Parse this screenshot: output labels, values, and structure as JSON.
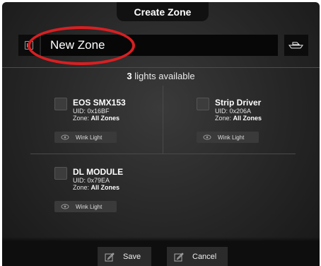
{
  "header": {
    "title": "Create Zone"
  },
  "zone_name": {
    "value": "New Zone"
  },
  "lights": {
    "count": "3",
    "count_suffix": "lights available"
  },
  "cards": [
    {
      "name": "EOS SMX153",
      "uid": "UID: 0x16BF",
      "zone_prefix": "Zone:",
      "zone_value": "All Zones",
      "wink_label": "Wink Light"
    },
    {
      "name": "Strip Driver",
      "uid": "UID: 0x206A",
      "zone_prefix": "Zone:",
      "zone_value": "All Zones",
      "wink_label": "Wink Light"
    },
    {
      "name": "DL MODULE",
      "uid": "UID: 0x79EA",
      "zone_prefix": "Zone:",
      "zone_value": "All Zones",
      "wink_label": "Wink Light"
    }
  ],
  "footer": {
    "save_label": "Save",
    "cancel_label": "Cancel"
  },
  "icons": {
    "keyboard": "keyboard-icon",
    "boat": "boat-icon",
    "eye": "eye-icon",
    "edit": "edit-icon"
  },
  "colors": {
    "highlight": "#d81f22",
    "background": "#262626",
    "field": "#070707"
  }
}
